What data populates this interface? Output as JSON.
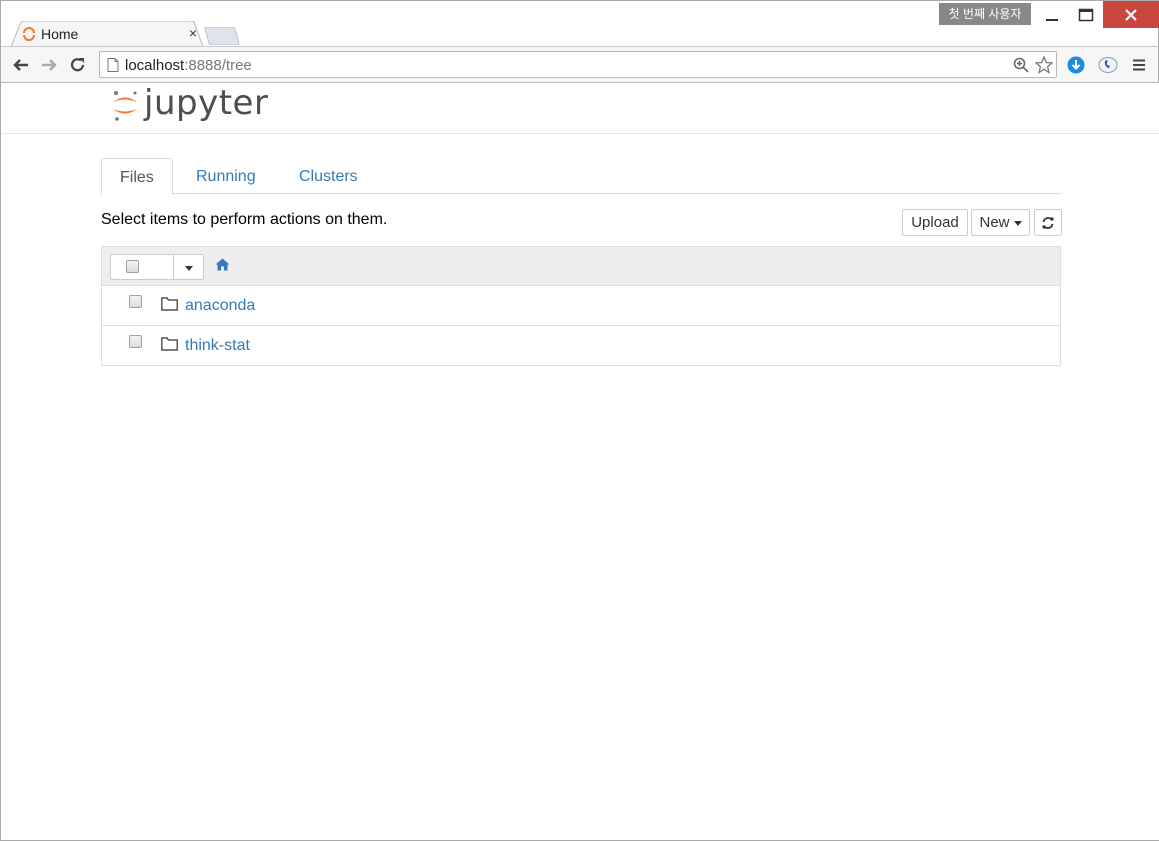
{
  "browser": {
    "tab_title": "Home",
    "tab_close": "×",
    "profile_label": "첫 번째 사용자",
    "url_host": "localhost",
    "url_rest": ":8888/tree"
  },
  "jupyter": {
    "logo_text": "jupyter",
    "tabs": [
      {
        "label": "Files",
        "active": true
      },
      {
        "label": "Running",
        "active": false
      },
      {
        "label": "Clusters",
        "active": false
      }
    ],
    "instructions": "Select items to perform actions on them.",
    "upload_label": "Upload",
    "new_label": "New",
    "items": [
      {
        "name": "anaconda",
        "type": "folder"
      },
      {
        "name": "think-stat",
        "type": "folder"
      }
    ]
  },
  "colors": {
    "link": "#337ab7",
    "jupyter_orange": "#f37726",
    "close_red": "#c7473e"
  },
  "icons": [
    "page-icon",
    "back-icon",
    "forward-icon",
    "reload-icon",
    "zoom-icon",
    "star-icon",
    "download-extension-icon",
    "phone-extension-icon",
    "menu-icon",
    "home-icon",
    "folder-icon",
    "refresh-icon"
  ]
}
